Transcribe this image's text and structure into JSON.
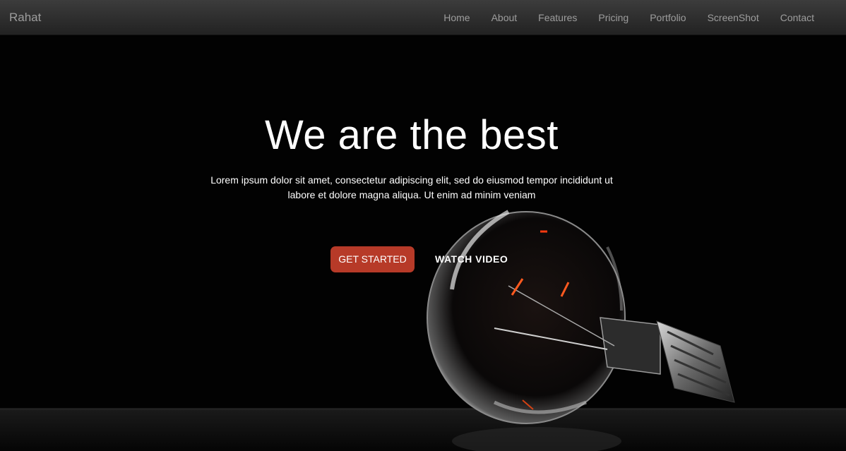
{
  "navbar": {
    "brand": "Rahat",
    "items": [
      {
        "label": "Home"
      },
      {
        "label": "About"
      },
      {
        "label": "Features"
      },
      {
        "label": "Pricing"
      },
      {
        "label": "Portfolio"
      },
      {
        "label": "ScreenShot"
      },
      {
        "label": "Contact"
      }
    ]
  },
  "hero": {
    "headline": "We are the best",
    "tagline": "Lorem ipsum dolor sit amet, consectetur adipiscing elit, sed do eiusmod tempor incididunt ut labore et dolore magna aliqua. Ut enim ad minim veniam",
    "primary_button": "GET STARTED",
    "secondary_button": "WATCH VIDEO"
  },
  "colors": {
    "accent": "#b73a28",
    "nav_text": "#9d9d9d",
    "background": "#000000"
  }
}
